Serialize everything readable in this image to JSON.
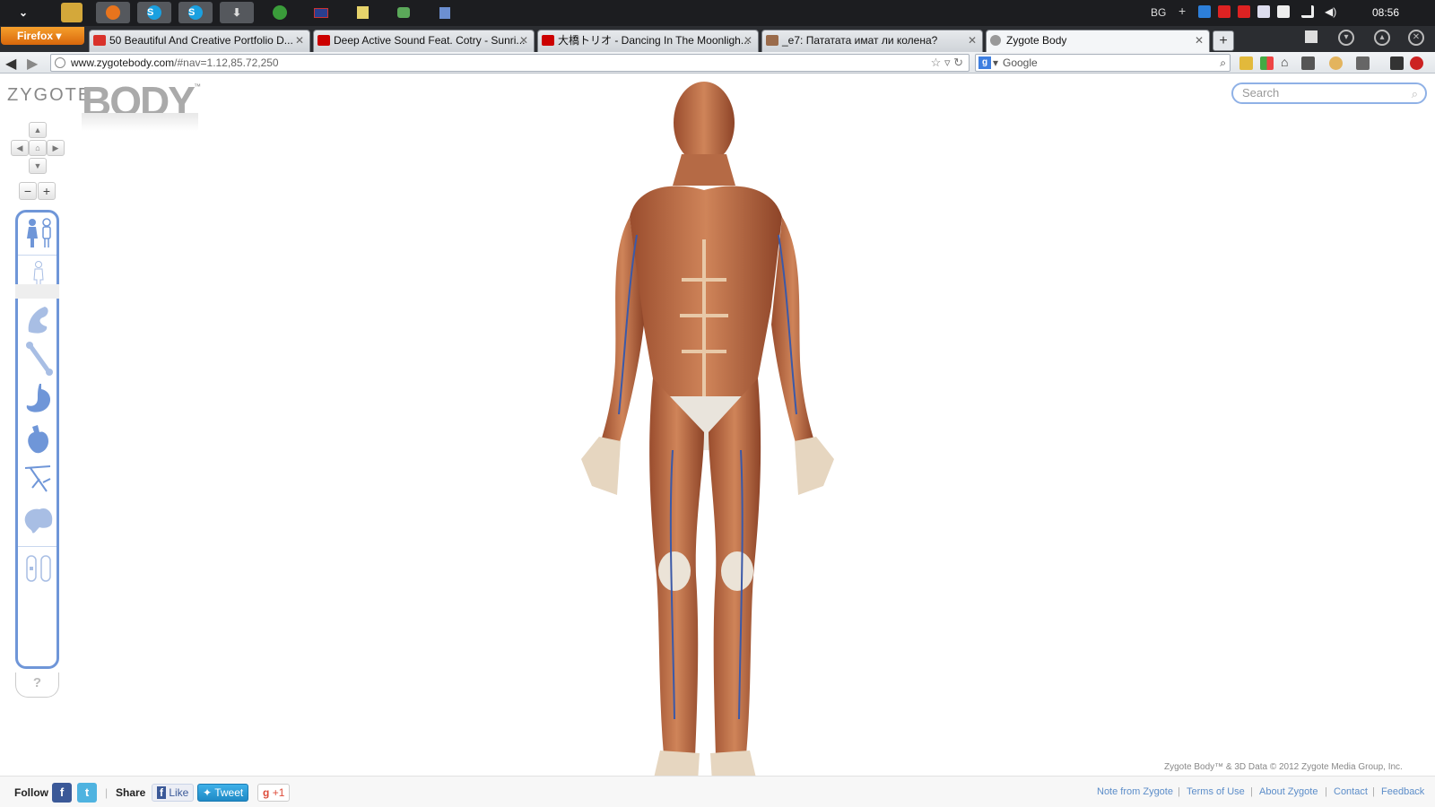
{
  "taskbar": {
    "language": "BG",
    "clock": "08:56"
  },
  "browser": {
    "menu_label": "Firefox",
    "tabs": [
      {
        "title": "50 Beautiful And Creative Portfolio D...",
        "favicon_color": "#d9322b"
      },
      {
        "title": "Deep Active Sound Feat. Cotry - Sunri...",
        "favicon_color": "#cc0000"
      },
      {
        "title": "大橋トリオ - Dancing In The Moonligh...",
        "favicon_color": "#cc0000"
      },
      {
        "title": "_e7: Пататата имат ли колена?",
        "favicon_color": "#9a6b4b"
      },
      {
        "title": "Zygote Body",
        "favicon_color": "#999999"
      }
    ],
    "new_tab_label": "+",
    "url_host": "www.zygotebody.com",
    "url_path": "/#nav=1.12,85.72,250",
    "search_engine": "Google",
    "search_placeholder": "Google"
  },
  "app": {
    "logo_small": "ZYGOTE",
    "logo_big": "BODY",
    "logo_tm": "™",
    "search_placeholder": "Search",
    "nav_pad": {
      "up": "▲",
      "down": "▼",
      "left": "◀",
      "right": "▶",
      "home": "⌂"
    },
    "zoom_out": "−",
    "zoom_in": "+",
    "layers": [
      {
        "name": "gender",
        "icon": "gender-icon"
      },
      {
        "name": "skin",
        "icon": "skin-body-icon"
      },
      {
        "name": "muscle",
        "icon": "muscle-icon"
      },
      {
        "name": "skeleton",
        "icon": "bone-icon"
      },
      {
        "name": "organs",
        "icon": "stomach-icon"
      },
      {
        "name": "circulatory",
        "icon": "heart-icon"
      },
      {
        "name": "nervous",
        "icon": "nerves-icon"
      },
      {
        "name": "brain",
        "icon": "brain-icon"
      }
    ],
    "help_label": "?",
    "copyright": "Zygote Body™ & 3D Data © 2012 Zygote Media Group, Inc.",
    "accent_color": "#6f96d8"
  },
  "footer": {
    "follow_label": "Follow",
    "share_label": "Share",
    "fb_label": "f",
    "tw_label": "t",
    "like_label": "Like",
    "tweet_label": "Tweet",
    "gplus_label": "+1",
    "links": [
      "Note from Zygote",
      "Terms of Use",
      "About Zygote",
      "Contact",
      "Feedback"
    ]
  }
}
